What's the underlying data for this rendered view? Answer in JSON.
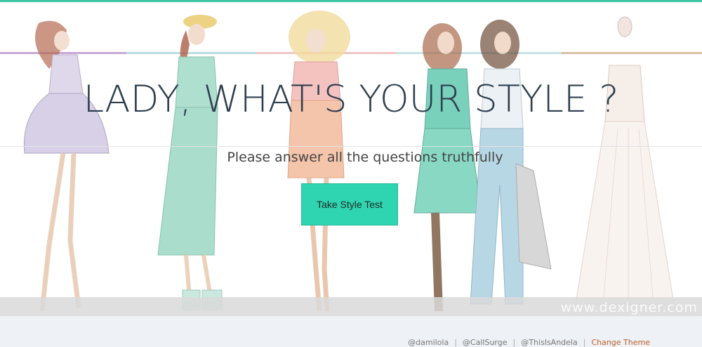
{
  "hero": {
    "headline": "LADY, WHAT'S YOUR STYLE ?",
    "subtitle": "Please answer all the questions truthfully",
    "cta_label": "Take Style Test",
    "watermark": "www.dexigner.com"
  },
  "footer": {
    "links": [
      {
        "label": "@damilola"
      },
      {
        "label": "@CallSurge"
      },
      {
        "label": "@ThisIsAndela"
      },
      {
        "label": "Change Theme"
      }
    ]
  },
  "colors": {
    "accent": "#3fc7a3",
    "cta": "#2fd4b0",
    "headline": "#2f3f4f",
    "theme_link": "#c0612a"
  }
}
